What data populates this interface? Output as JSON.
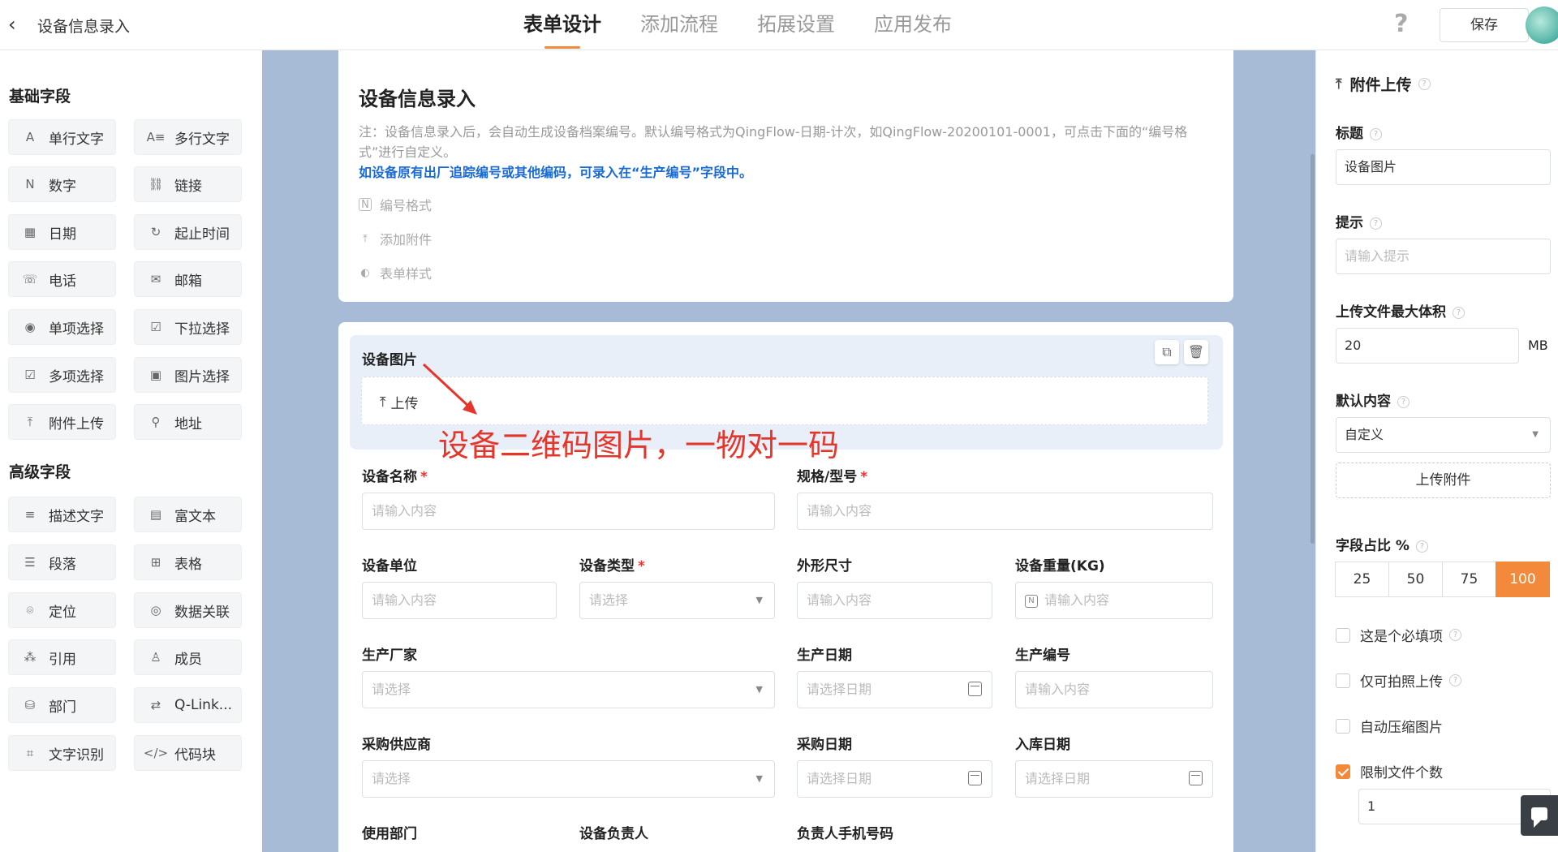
{
  "header": {
    "title": "设备信息录入",
    "tabs": [
      "表单设计",
      "添加流程",
      "拓展设置",
      "应用发布"
    ],
    "help": "?",
    "save_label": "保存"
  },
  "sidebar": {
    "basic_title": "基础字段",
    "basic_items": [
      {
        "icon": "A",
        "label": "单行文字"
      },
      {
        "icon": "A≡",
        "label": "多行文字"
      },
      {
        "icon": "N",
        "label": "数字"
      },
      {
        "icon": "⛓",
        "label": "链接"
      },
      {
        "icon": "▦",
        "label": "日期"
      },
      {
        "icon": "↻",
        "label": "起止时间"
      },
      {
        "icon": "☏",
        "label": "电话"
      },
      {
        "icon": "✉",
        "label": "邮箱"
      },
      {
        "icon": "◉",
        "label": "单项选择"
      },
      {
        "icon": "☑",
        "label": "下拉选择"
      },
      {
        "icon": "☑",
        "label": "多项选择"
      },
      {
        "icon": "▣",
        "label": "图片选择"
      },
      {
        "icon": "⤒",
        "label": "附件上传"
      },
      {
        "icon": "⚲",
        "label": "地址"
      }
    ],
    "advanced_title": "高级字段",
    "advanced_items": [
      {
        "icon": "≡",
        "label": "描述文字"
      },
      {
        "icon": "▤",
        "label": "富文本"
      },
      {
        "icon": "☰",
        "label": "段落"
      },
      {
        "icon": "⊞",
        "label": "表格"
      },
      {
        "icon": "⌾",
        "label": "定位"
      },
      {
        "icon": "◎",
        "label": "数据关联"
      },
      {
        "icon": "⁂",
        "label": "引用"
      },
      {
        "icon": "♙",
        "label": "成员"
      },
      {
        "icon": "⛁",
        "label": "部门"
      },
      {
        "icon": "⇄",
        "label": "Q-Link..."
      },
      {
        "icon": "⌗",
        "label": "文字识别"
      },
      {
        "icon": "</>",
        "label": "代码块"
      }
    ]
  },
  "form": {
    "title": "设备信息录入",
    "note": "注：设备信息录入后，会自动生成设备档案编号。默认编号格式为QingFlow-日期-计次，如QingFlow-20200101-0001，可点击下面的“编号格式”进行自定义。",
    "note_blue": "如设备原有出厂追踪编号或其他编码，可录入在“生产编号”字段中。",
    "options": [
      "编号格式",
      "添加附件",
      "表单样式"
    ],
    "selected_field_label": "设备图片",
    "upload_label": "上传",
    "annotation": "设备二维码图片，一物对一码",
    "fields": {
      "name": {
        "label": "设备名称",
        "placeholder": "请输入内容"
      },
      "spec": {
        "label": "规格/型号",
        "placeholder": "请输入内容"
      },
      "unit": {
        "label": "设备单位",
        "placeholder": "请输入内容"
      },
      "type": {
        "label": "设备类型",
        "placeholder": "请选择"
      },
      "size": {
        "label": "外形尺寸",
        "placeholder": "请输入内容"
      },
      "weight": {
        "label": "设备重量(KG)",
        "placeholder": "请输入内容"
      },
      "maker": {
        "label": "生产厂家",
        "placeholder": "请选择"
      },
      "prod_date": {
        "label": "生产日期",
        "placeholder": "请选择日期"
      },
      "serial": {
        "label": "生产编号",
        "placeholder": "请输入内容"
      },
      "supplier": {
        "label": "采购供应商",
        "placeholder": "请选择"
      },
      "buy_date": {
        "label": "采购日期",
        "placeholder": "请选择日期"
      },
      "in_date": {
        "label": "入库日期",
        "placeholder": "请选择日期"
      },
      "dept": {
        "label": "使用部门"
      },
      "owner": {
        "label": "设备负责人"
      },
      "phone": {
        "label": "负责人手机号码"
      }
    },
    "required_mark": "*"
  },
  "props": {
    "header": "附件上传",
    "title_label": "标题",
    "title_value": "设备图片",
    "hint_label": "提示",
    "hint_placeholder": "请输入提示",
    "max_size_label": "上传文件最大体积",
    "max_size_value": "20",
    "max_size_unit": "MB",
    "default_label": "默认内容",
    "default_value": "自定义",
    "upload_btn": "上传附件",
    "ratio_label": "字段占比 %",
    "ratio_options": [
      "25",
      "50",
      "75",
      "100"
    ],
    "ratio_selected": "100",
    "checks": [
      {
        "label": "这是个必填项",
        "checked": false,
        "hint": true
      },
      {
        "label": "仅可拍照上传",
        "checked": false,
        "hint": true
      },
      {
        "label": "自动压缩图片",
        "checked": false,
        "hint": false
      },
      {
        "label": "限制文件个数",
        "checked": true,
        "hint": false
      }
    ],
    "file_count_value": "1"
  },
  "colors": {
    "accent": "#f38a3b",
    "canvas_bg": "#a7bbd6",
    "annotation_red": "#e5362b",
    "link_blue": "#1a6ad6"
  }
}
